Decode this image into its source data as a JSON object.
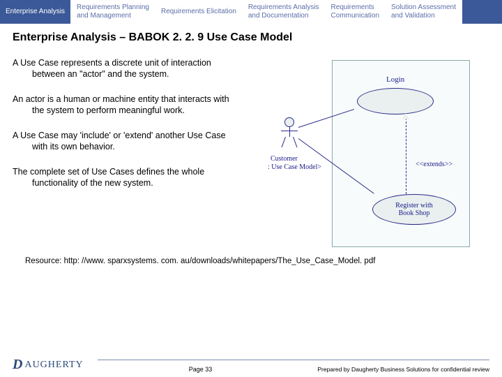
{
  "tabs": {
    "t0": "Enterprise Analysis",
    "t1": "Requirements Planning\nand Management",
    "t2": "Requirements Elicitation",
    "t3": "Requirements Analysis\nand Documentation",
    "t4": "Requirements\nCommunication",
    "t5": "Solution Assessment\nand Validation"
  },
  "title": "Enterprise Analysis – BABOK 2. 2. 9 Use Case Model",
  "paragraphs": {
    "p1": "A Use Case represents a discrete unit of interaction between an \"actor\" and the system.",
    "p2": "An actor is a human or machine entity that interacts with the system to perform meaningful work.",
    "p3": "A Use Case may 'include' or 'extend' another Use Case with its own behavior.",
    "p4": "The complete set of Use Cases defines the whole functionality of the new system."
  },
  "diagram": {
    "login_label": "Login",
    "actor_label": "Customer",
    "model_label": ": Use Case Model>",
    "extends_label": "<<extends>>",
    "register_label": "Register with\nBook Shop"
  },
  "resource": "Resource: http: //www. sparxsystems. com. au/downloads/whitepapers/The_Use_Case_Model. pdf",
  "footer": {
    "logo_text": "AUGHERTY",
    "page": "Page 33",
    "prepared": "Prepared by Daugherty Business Solutions for confidential review"
  }
}
